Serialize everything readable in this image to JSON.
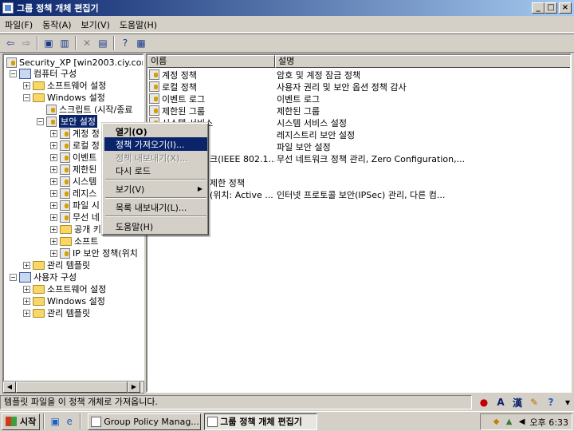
{
  "window": {
    "title": "그룹 정책 개체 편집기",
    "min": "_",
    "max": "□",
    "close": "×"
  },
  "menu": [
    "파일(F)",
    "동작(A)",
    "보기(V)",
    "도움말(H)"
  ],
  "tree": {
    "root": "Security_XP [win2003.ciy.cor",
    "computer_config": "컴퓨터 구성",
    "software_settings": "소프트웨어 설정",
    "windows_settings": "Windows 설정",
    "scripts": "스크립트 (시작/종료",
    "security_settings": "보안 설정",
    "children": [
      "계정 정",
      "로컬 정",
      "이벤트",
      "제한된",
      "시스템",
      "레지스",
      "파일 시",
      "무선 네",
      "공개 키",
      "소프트",
      "IP 보안 정책(위치"
    ],
    "admin_templates": "관리 템플릿",
    "user_config": "사용자 구성",
    "user_software": "소프트웨어 설정",
    "user_windows": "Windows 설정",
    "user_admin": "관리 템플릿"
  },
  "list": {
    "columns": [
      "이름",
      "설명"
    ],
    "rows": [
      {
        "name": "계정 정책",
        "desc": "암호 및 계정 잠금 정책"
      },
      {
        "name": "로컬 정책",
        "desc": "사용자 권리 및 보안 옵션 정책 감사"
      },
      {
        "name": "이벤트 로그",
        "desc": "이벤트 로그"
      },
      {
        "name": "제한된 그룹",
        "desc": "제한된 그룹"
      },
      {
        "name": "시스템 서비스",
        "desc": "시스템 서비스 설정"
      },
      {
        "name": "",
        "desc": "레지스트리 보안 설정"
      },
      {
        "name": "",
        "desc": "파일 보안 설정"
      },
      {
        "name": "크(IEEE 802.1...",
        "desc": "무선 네트워크 정책 관리, Zero Configuration,..."
      },
      {
        "name": "",
        "desc": ""
      },
      {
        "name": "제한 정책",
        "desc": ""
      },
      {
        "name": "(위치: Active ...",
        "desc": "인터넷 프로토콜 보안(IPSec) 관리, 다른 컴..."
      }
    ]
  },
  "context_menu": {
    "open": "열기(O)",
    "import": "정책 가져오기(I)...",
    "export": "정책 내보내기(X)...",
    "reload": "다시 로드",
    "view": "보기(V)",
    "export_list": "목록 내보내기(L)...",
    "help": "도움말(H)"
  },
  "status": "템플릿 파일을 이 정책 개체로 가져옵니다.",
  "ime": {
    "lang": "A",
    "hanja": "漢"
  },
  "taskbar": {
    "start": "시작",
    "tasks": [
      "Group Policy Manag...",
      "그룹 정책 개체 편집기"
    ],
    "clock": "오후 6:33"
  }
}
